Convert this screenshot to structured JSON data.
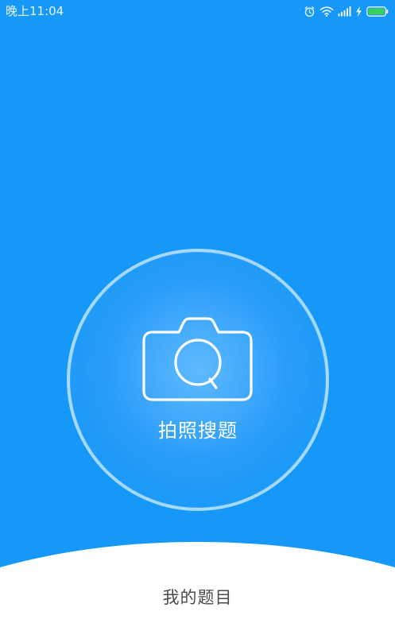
{
  "status_bar": {
    "time": "晚上11:04",
    "icons": [
      "alarm-icon",
      "wifi-icon",
      "signal-icon",
      "charging-icon",
      "battery-icon"
    ],
    "battery_color": "#37d05a"
  },
  "main": {
    "capture_label": "拍照搜题",
    "camera_icon": "camera-search-icon",
    "accent_color": "#1598f7",
    "ring_color": "#a5dafd"
  },
  "bottom": {
    "my_questions_label": "我的题目"
  }
}
